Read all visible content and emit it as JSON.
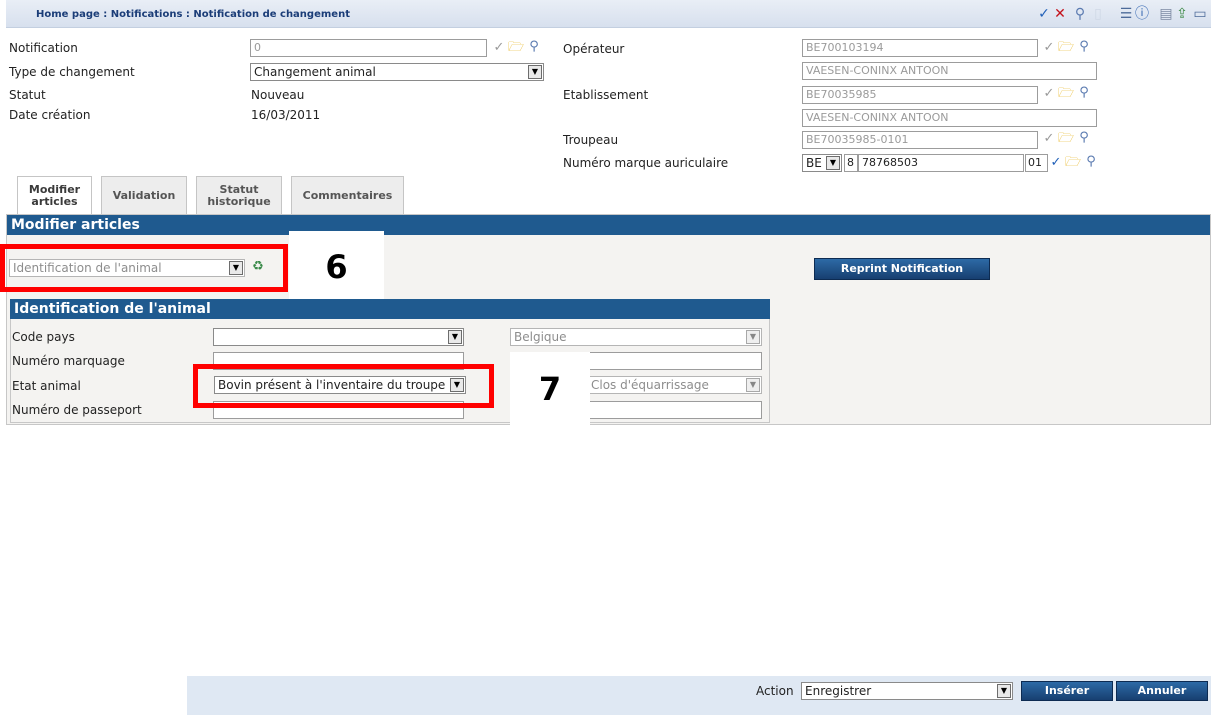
{
  "breadcrumb": "Home page : Notifications : Notification de changement",
  "toolbar_icons": [
    "check-icon",
    "close-icon",
    "search-icon",
    "document-icon",
    "list-icon",
    "info-icon",
    "print-icon",
    "export-icon",
    "window-icon"
  ],
  "header": {
    "notification_label": "Notification",
    "notification_value": "0",
    "type_label": "Type de changement",
    "type_value": "Changement animal",
    "statut_label": "Statut",
    "statut_value": "Nouveau",
    "date_label": "Date création",
    "date_value": "16/03/2011",
    "operateur_label": "Opérateur",
    "operateur_id": "BE700103194",
    "operateur_name": "VAESEN-CONINX ANTOON",
    "etablissement_label": "Etablissement",
    "etablissement_id": "BE70035985",
    "etablissement_name": "VAESEN-CONINX ANTOON",
    "troupeau_label": "Troupeau",
    "troupeau_value": "BE70035985-0101",
    "marque_label": "Numéro marque auriculaire",
    "marque_country": "BE",
    "marque_check": "8",
    "marque_number": "78768503",
    "marque_suffix": "01"
  },
  "tabs": [
    {
      "line1": "Modifier",
      "line2": "articles"
    },
    {
      "line1": "Validation",
      "line2": ""
    },
    {
      "line1": "Statut",
      "line2": "historique"
    },
    {
      "line1": "Commentaires",
      "line2": ""
    }
  ],
  "section_title": "Modifier articles",
  "article_select": "Identification de l'animal",
  "reprint_button": "Reprint Notification",
  "annotation_6": "6",
  "annotation_7": "7",
  "subsection_title": "Identification de l'animal",
  "rows": {
    "code_pays_label": "Code pays",
    "code_pays_new": "",
    "code_pays_old": "Belgique",
    "numero_marquage_label": "Numéro marquage",
    "etat_animal_label": "Etat animal",
    "etat_animal_new": "Bovin présent à l'inventaire du troupe",
    "etat_animal_old": "Clos d'équarrissage",
    "passeport_label": "Numéro de passeport"
  },
  "footer": {
    "action_label": "Action",
    "action_value": "Enregistrer",
    "inserer_button": "Insérer",
    "annuler_button": "Annuler"
  }
}
